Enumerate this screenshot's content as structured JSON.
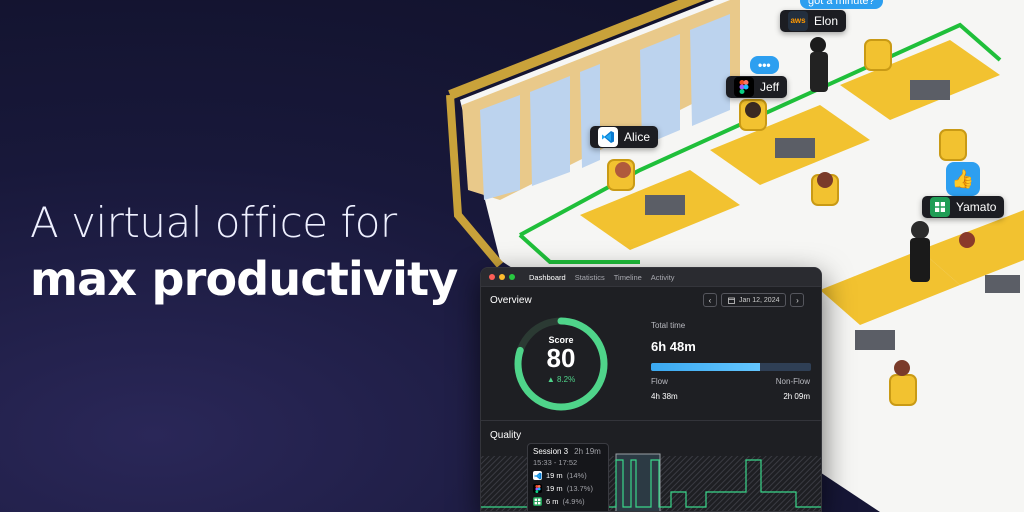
{
  "hero": {
    "line1": "A virtual office for",
    "line2": "max productivity"
  },
  "office": {
    "users": [
      {
        "name": "Elon",
        "app_icon": "aws-icon",
        "app_text": "aws"
      },
      {
        "name": "Jeff",
        "app_icon": "figma-icon"
      },
      {
        "name": "Alice",
        "app_icon": "vscode-icon"
      },
      {
        "name": "Yamato",
        "app_icon": "spreadsheet-icon"
      }
    ],
    "message_bubble": "got a minute?",
    "typing_bubble": "•••",
    "reaction": "thumbs-up-icon",
    "colors": {
      "desk": "#f2c230",
      "floor_line": "#1fbf3a",
      "wall_trim": "#c9a23a"
    }
  },
  "app": {
    "tabs": [
      {
        "label": "Dashboard",
        "active": true
      },
      {
        "label": "Statistics",
        "active": false
      },
      {
        "label": "Timeline",
        "active": false
      },
      {
        "label": "Activity",
        "active": false
      }
    ],
    "overview": {
      "title": "Overview",
      "date": "Jan 12, 2024",
      "prev_icon": "chevron-left-icon",
      "next_icon": "chevron-right-icon",
      "score_label": "Score",
      "score": "80",
      "score_fraction": 0.8,
      "score_delta": "▲ 8.2%",
      "total_label": "Total time",
      "total_value": "6h 48m",
      "flow_fraction": 0.68,
      "flow_label": "Flow",
      "nonflow_label": "Non-Flow",
      "flow_time": "4h 38m",
      "nonflow_time": "2h 09m",
      "accent": "#4fd48a",
      "flow_color": "#3aa8f0"
    },
    "quality": {
      "title": "Quality",
      "session": {
        "title": "Session 3",
        "duration": "2h 19m",
        "range": "15:33 - 17:52",
        "apps": [
          {
            "icon": "vscode-icon",
            "time": "19 m",
            "pct": "(14%)"
          },
          {
            "icon": "figma-icon",
            "time": "19 m",
            "pct": "(13.7%)"
          },
          {
            "icon": "spreadsheet-icon",
            "time": "6 m",
            "pct": "(4.9%)"
          }
        ]
      }
    }
  }
}
